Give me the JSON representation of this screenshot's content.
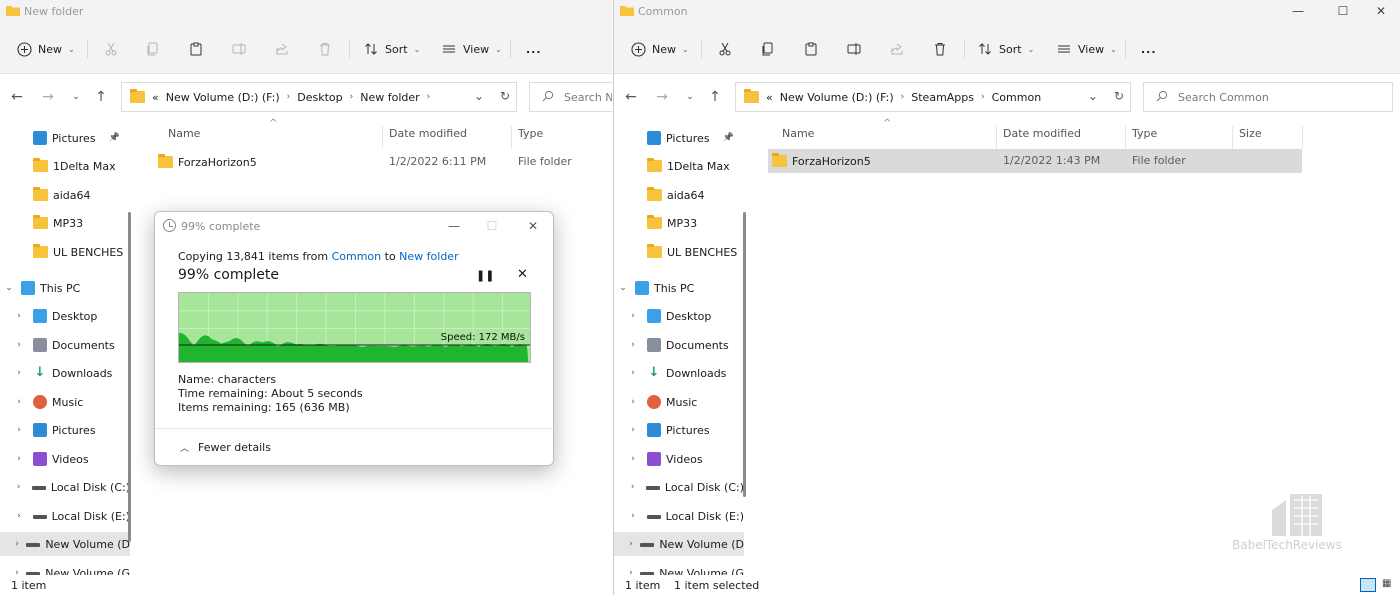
{
  "colors": {
    "accent": "#0067c0",
    "folder": "#f8c33c",
    "graph_fill": "#1fb52f",
    "graph_bg": "#a7e59b",
    "selection": "#dadada"
  },
  "left": {
    "title": "New folder",
    "toolbar": {
      "new": "New",
      "sort": "Sort",
      "view": "View",
      "more": "..."
    },
    "address": {
      "prefix": "«",
      "crumbs": [
        "New Volume (D:) (F:)",
        "Desktop",
        "New folder"
      ]
    },
    "search_placeholder": "Search Ne",
    "nav": [
      {
        "label": "Pictures",
        "icon": "pictures-icon",
        "pinned": true
      },
      {
        "label": "1Delta Max",
        "icon": "folder-icon"
      },
      {
        "label": "aida64",
        "icon": "folder-icon"
      },
      {
        "label": "MP33",
        "icon": "folder-icon"
      },
      {
        "label": "UL BENCHES",
        "icon": "folder-icon"
      },
      {
        "label": "This PC",
        "icon": "pc-icon",
        "expanded": true
      },
      {
        "label": "Desktop",
        "icon": "desktop-icon"
      },
      {
        "label": "Documents",
        "icon": "documents-icon"
      },
      {
        "label": "Downloads",
        "icon": "downloads-icon"
      },
      {
        "label": "Music",
        "icon": "music-icon"
      },
      {
        "label": "Pictures",
        "icon": "pictures-icon"
      },
      {
        "label": "Videos",
        "icon": "videos-icon"
      },
      {
        "label": "Local Disk (C:)",
        "icon": "drive-icon"
      },
      {
        "label": "Local Disk (E:)",
        "icon": "drive-icon"
      },
      {
        "label": "New Volume (D",
        "icon": "drive-icon",
        "selected": true
      },
      {
        "label": "New Volume (G",
        "icon": "drive-icon"
      }
    ],
    "columns": {
      "name": "Name",
      "date": "Date modified",
      "type": "Type"
    },
    "files": [
      {
        "name": "ForzaHorizon5",
        "date": "1/2/2022 6:11 PM",
        "type": "File folder"
      }
    ],
    "status": "1 item"
  },
  "right": {
    "title": "Common",
    "toolbar": {
      "new": "New",
      "sort": "Sort",
      "view": "View",
      "more": "..."
    },
    "address": {
      "prefix": "«",
      "crumbs": [
        "New Volume (D:) (F:)",
        "SteamApps",
        "Common"
      ]
    },
    "search_placeholder": "Search Common",
    "nav": [
      {
        "label": "Pictures",
        "icon": "pictures-icon",
        "pinned": true
      },
      {
        "label": "1Delta Max",
        "icon": "folder-icon"
      },
      {
        "label": "aida64",
        "icon": "folder-icon"
      },
      {
        "label": "MP33",
        "icon": "folder-icon"
      },
      {
        "label": "UL BENCHES",
        "icon": "folder-icon"
      },
      {
        "label": "This PC",
        "icon": "pc-icon",
        "expanded": true
      },
      {
        "label": "Desktop",
        "icon": "desktop-icon"
      },
      {
        "label": "Documents",
        "icon": "documents-icon"
      },
      {
        "label": "Downloads",
        "icon": "downloads-icon"
      },
      {
        "label": "Music",
        "icon": "music-icon"
      },
      {
        "label": "Pictures",
        "icon": "pictures-icon"
      },
      {
        "label": "Videos",
        "icon": "videos-icon"
      },
      {
        "label": "Local Disk (C:)",
        "icon": "drive-icon"
      },
      {
        "label": "Local Disk (E:)",
        "icon": "drive-icon"
      },
      {
        "label": "New Volume (D",
        "icon": "drive-icon",
        "selected": true
      },
      {
        "label": "New Volume (G",
        "icon": "drive-icon"
      }
    ],
    "columns": {
      "name": "Name",
      "date": "Date modified",
      "type": "Type",
      "size": "Size"
    },
    "files": [
      {
        "name": "ForzaHorizon5",
        "date": "1/2/2022 1:43 PM",
        "type": "File folder",
        "selected": true
      }
    ],
    "status": "1 item",
    "status_selected": "1 item selected"
  },
  "dialog": {
    "title": "99% complete",
    "copy_prefix": "Copying 13,841 items from",
    "copy_source": "Common",
    "copy_to": "to",
    "copy_dest": "New folder",
    "heading": "99% complete",
    "progress": 0.99,
    "speed": "Speed: 172 MB/s",
    "name_label": "Name:",
    "name_value": "characters",
    "time_label": "Time remaining:",
    "time_value": "About 5 seconds",
    "items_label": "Items remaining:",
    "items_value": "165 (636 MB)",
    "fewer_details": "Fewer details"
  },
  "watermark": "BabelTechReviews"
}
